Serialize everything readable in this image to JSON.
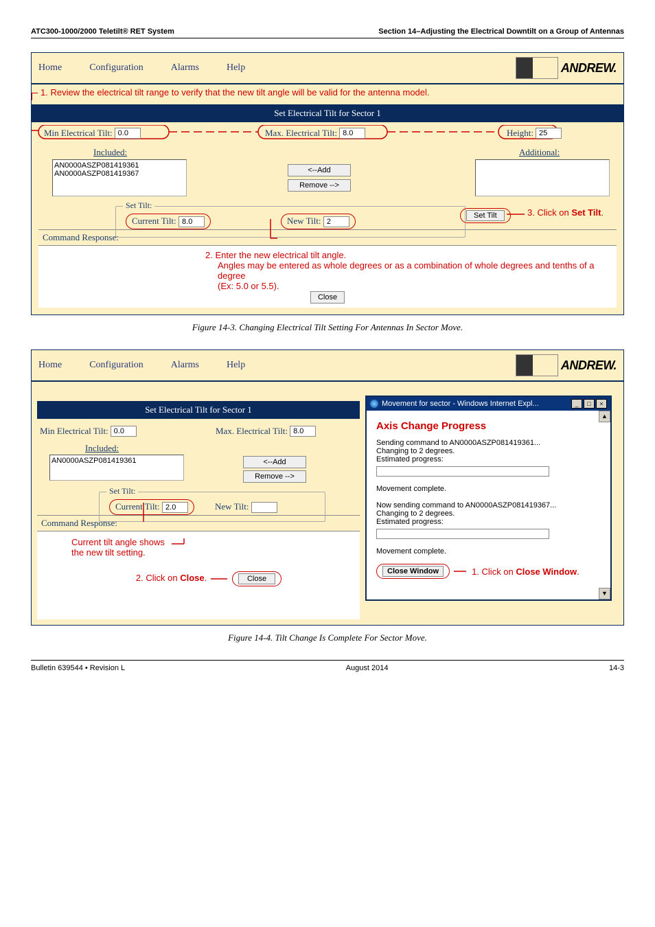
{
  "header": {
    "left": "ATC300-1000/2000 Teletilt® RET System",
    "right": "Section 14–Adjusting the Electrical Downtilt on a Group of Antennas"
  },
  "menu": {
    "home": "Home",
    "config": "Configuration",
    "alarms": "Alarms",
    "help": "Help",
    "logo_text": "ANDREW."
  },
  "fig1": {
    "step1": "1. Review the electrical tilt range to verify that the new tilt angle will be valid for the antenna model.",
    "section_title": "Set Electrical Tilt for Sector 1",
    "min_tilt_label": "Min Electrical Tilt:",
    "min_tilt_val": "0.0",
    "max_tilt_label": "Max. Electrical Tilt:",
    "max_tilt_val": "8.0",
    "height_label": "Height:",
    "height_val": "25",
    "included_label": "Included:",
    "additional_label": "Additional:",
    "list_item1": "AN0000ASZP081419361",
    "list_item2": "AN0000ASZP081419367",
    "add_btn": "<--Add",
    "remove_btn": "Remove -->",
    "set_tilt_group": "Set Tilt:",
    "current_tilt_label": "Current Tilt:",
    "current_tilt_val": "8.0",
    "new_tilt_label": "New Tilt:",
    "new_tilt_val": "2",
    "set_tilt_btn": "Set Tilt",
    "step3": "3. Click on Set Tilt.",
    "cmd_resp": "Command Response:",
    "step2a": "2.  Enter the new electrical tilt angle.",
    "step2b": "Angles may be entered as whole degrees or as a combination of whole degrees and tenths of a degree",
    "step2c": "(Ex: 5.0 or 5.5).",
    "close_btn": "Close",
    "caption": "Figure 14-3.  Changing Electrical Tilt Setting For Antennas In Sector Move."
  },
  "fig2": {
    "section_title": "Set Electrical Tilt for Sector 1",
    "min_tilt_label": "Min Electrical Tilt:",
    "min_tilt_val": "0.0",
    "max_tilt_label": "Max. Electrical Tilt:",
    "max_tilt_val": "8.0",
    "included_label": "Included:",
    "list_item1": "AN0000ASZP081419361",
    "add_btn": "<--Add",
    "remove_btn": "Remove -->",
    "set_tilt_group": "Set Tilt:",
    "current_tilt_label": "Current Tilt:",
    "current_tilt_val": "2.0",
    "new_tilt_label": "New Tilt:",
    "cmd_resp": "Command Response:",
    "annot_current": "Current tilt angle shows the new tilt setting.",
    "annot_close": "2.  Click on Close.",
    "close_btn": "Close",
    "popup_title": "Movement for sector - Windows Internet Expl...",
    "popup_heading": "Axis Change Progress",
    "popup_line1": "Sending command to AN0000ASZP081419361...",
    "popup_line2": "Changing to 2 degrees.",
    "popup_line3": "Estimated progress:",
    "popup_done": "Movement complete.",
    "popup_line4": "Now sending command to AN0000ASZP081419367...",
    "popup_line5": "Changing to 2 degrees.",
    "popup_line6": "Estimated progress:",
    "popup_done2": "Movement complete.",
    "close_window_btn": "Close Window",
    "annot_close_win": "1.  Click on Close Window.",
    "caption": "Figure 14-4.  Tilt Change Is Complete For Sector Move."
  },
  "footer": {
    "left": "Bulletin 639544  •  Revision L",
    "center": "August 2014",
    "right": "14-3"
  }
}
